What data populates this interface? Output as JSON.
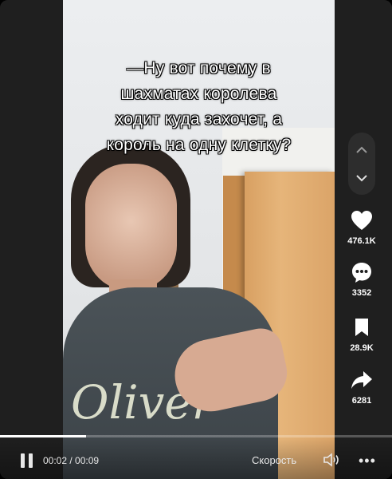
{
  "caption": {
    "lines": [
      "—Ну вот почему в",
      "шахматах королева",
      "ходит куда захочет, а",
      "король на одну клетку?"
    ]
  },
  "actions": {
    "likes": "476.1K",
    "comments": "3352",
    "saves": "28.9K",
    "shares": "6281"
  },
  "playback": {
    "time": "00:02 / 00:09",
    "speed_label": "Скорость",
    "progress_fraction": 0.22
  },
  "shirt_text": "Oliver",
  "icons": {
    "nav_up": "chevron-up-icon",
    "nav_down": "chevron-down-icon",
    "like": "heart-icon",
    "comment": "comment-icon",
    "save": "bookmark-icon",
    "share": "share-icon",
    "pause": "pause-icon",
    "volume": "volume-icon",
    "more": "more-icon"
  },
  "colors": {
    "text": "#ffffff",
    "background": "#1f1f1f"
  }
}
